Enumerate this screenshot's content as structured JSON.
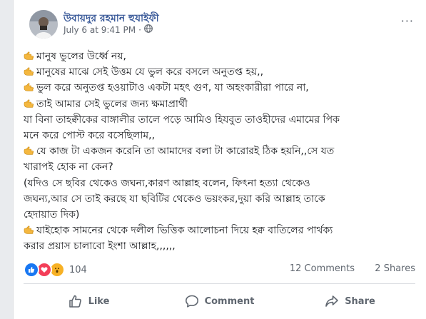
{
  "post": {
    "author": "উবায়দুর রহমান হুযাইফী",
    "timestamp": "July 6 at 9:41 PM",
    "separator": "·",
    "privacy_icon": "globe-icon",
    "more_icon": "···",
    "lines": [
      {
        "hand": true,
        "text": "মানুষ ভুলের উর্ধ্বে নয়,"
      },
      {
        "hand": true,
        "text": "মানুষের মাঝে সেই উত্তম যে ভুল করে বসলে অনুতপ্ত হয়,,"
      },
      {
        "hand": true,
        "text": "ভুল করে অনুতপ্ত হওয়াটাও একটা মহৎ গুণ, যা অহংকারীরা পারে না,"
      },
      {
        "hand": true,
        "text": "তাই আমার সেই ভুলের জন্য ক্ষমাপ্রার্থী"
      },
      {
        "hand": false,
        "text": "যা বিনা তাহক্বীকের বাঙ্গালীর তালে পড়ে আমিও হিযবুত তাওহীদের এমামের পিক"
      },
      {
        "hand": false,
        "text": "মনে করে পোস্ট করে বসেছিলাম,,"
      },
      {
        "hand": true,
        "text": "যে কাজ টা একজন করেনি তা আমাদের বলা টা কারোরই ঠিক হয়নি,,সে যত"
      },
      {
        "hand": false,
        "text": "খারাপই হোক না কেন?"
      },
      {
        "hand": false,
        "text": "(যদিও সে ছবির থেকেও জঘন্য,কারণ আল্লাহ বলেন, ফিৎনা হত্যা থেকেও"
      },
      {
        "hand": false,
        "text": "জঘন্য,আর সে তাই করছে যা ছবিটির থেকেও ভয়ংকর,দুয়া করি আল্লাহ তাকে"
      },
      {
        "hand": false,
        "text": "হেদায়াত দিক)"
      },
      {
        "hand": true,
        "text": "যাইহোক সামনের থেকে দলীল ভিত্তিক আলোচনা দিয়ে হক্ব বাতিলের পার্থক্য"
      },
      {
        "hand": false,
        "text": "করার প্রয়াস চালাবো ইংশা আল্লাহ,,,,,,"
      }
    ]
  },
  "stats": {
    "reaction_icons": [
      "like-reaction-icon",
      "love-reaction-icon",
      "wow-reaction-icon"
    ],
    "reaction_count": "104",
    "comments": "12 Comments",
    "shares": "2 Shares"
  },
  "actions": {
    "like": "Like",
    "comment": "Comment",
    "share": "Share"
  },
  "colors": {
    "author": "#385898",
    "like_blue": "#1877f2",
    "love_red": "#f33e58",
    "wow_yellow": "#f7b125",
    "muted": "#606770"
  }
}
